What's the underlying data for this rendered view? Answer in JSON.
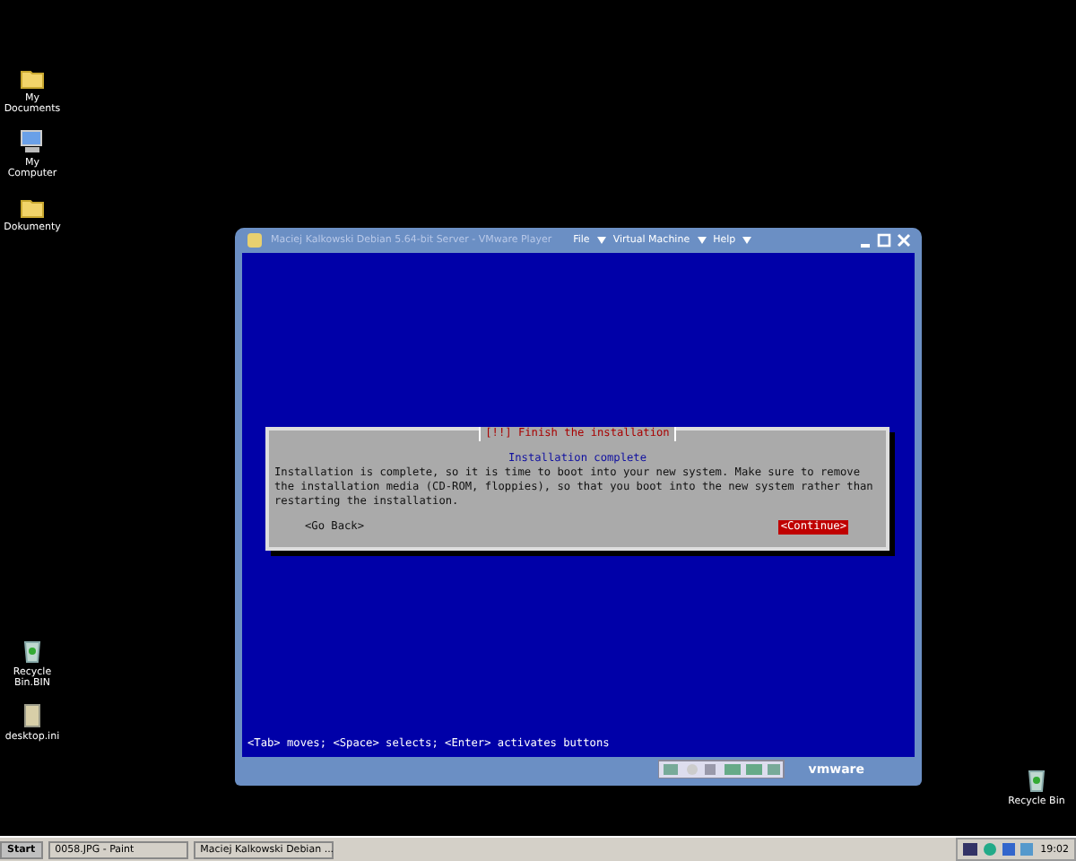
{
  "desktop_icons": [
    {
      "label": "My Documents",
      "kind": "documents"
    },
    {
      "label": "My Computer",
      "kind": "computer"
    },
    {
      "label": "Dokumenty",
      "kind": "folder"
    },
    {
      "label": "Recycle Bin.BIN",
      "kind": "bin"
    },
    {
      "label": "desktop.ini",
      "kind": "file"
    },
    {
      "label": "Recycle Bin",
      "kind": "bin"
    }
  ],
  "window": {
    "title": "Maciej Kalkowski Debian 5.64-bit Server - VMware Player",
    "menu": [
      "File",
      "Virtual Machine",
      "Help"
    ],
    "brand": "vmware"
  },
  "dialog": {
    "title": "[!!] Finish the installation",
    "heading": "Installation complete",
    "message": "Installation is complete, so it is time to boot into your new system. Make sure to remove the installation media (CD-ROM, floppies), so that you boot into the new system rather than restarting the installation.",
    "buttons": [
      {
        "label": "<Go Back>",
        "selected": false
      },
      {
        "label": "<Continue>",
        "selected": true
      }
    ]
  },
  "help_line": "<Tab> moves; <Space> selects; <Enter> activates buttons",
  "taskbar": {
    "start": "Start",
    "tasks": [
      "0058.JPG - Paint",
      "Maciej Kalkowski Debian ..."
    ],
    "clock": "19:02"
  }
}
